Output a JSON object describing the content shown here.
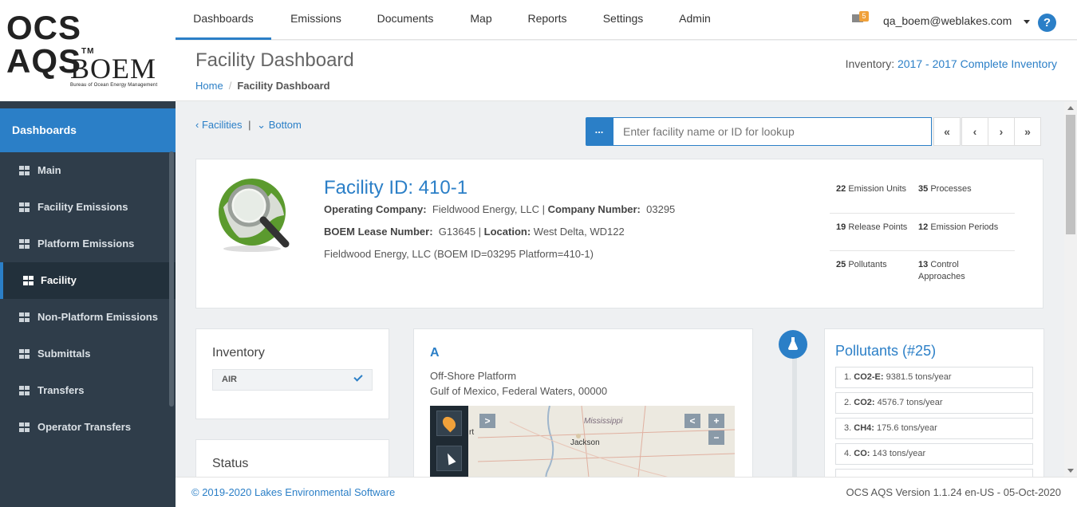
{
  "logo": {
    "app_name": "OCS AQS",
    "tm": "TM",
    "agency": "BOEM",
    "agency_sub": "Bureau of Ocean Energy Management"
  },
  "topnav": {
    "tabs": [
      {
        "label": "Dashboards",
        "active": true
      },
      {
        "label": "Emissions"
      },
      {
        "label": "Documents"
      },
      {
        "label": "Map"
      },
      {
        "label": "Reports"
      },
      {
        "label": "Settings"
      },
      {
        "label": "Admin"
      }
    ],
    "mail_count": "5",
    "user": "qa_boem@weblakes.com",
    "help": "?"
  },
  "header": {
    "title": "Facility Dashboard",
    "breadcrumb": {
      "home": "Home",
      "sep": "/",
      "current": "Facility Dashboard"
    },
    "inventory_label": "Inventory:",
    "inventory_value": "2017 - 2017 Complete Inventory"
  },
  "sidebar": {
    "section": "Dashboards",
    "items": [
      {
        "label": "Main"
      },
      {
        "label": "Facility Emissions"
      },
      {
        "label": "Platform Emissions"
      },
      {
        "label": "Facility",
        "active": true
      },
      {
        "label": "Non-Platform Emissions"
      },
      {
        "label": "Submittals"
      },
      {
        "label": "Transfers"
      },
      {
        "label": "Operator Transfers"
      }
    ]
  },
  "toolbar": {
    "facilities_link": "Facilities",
    "separator": "|",
    "bottom_link": "Bottom",
    "lookup_button": "...",
    "lookup_placeholder": "Enter facility name or ID for lookup",
    "pager": [
      "«",
      "‹",
      "›",
      "»"
    ]
  },
  "facility": {
    "title": "Facility ID: 410-1",
    "op_company_label": "Operating Company:",
    "op_company": "Fieldwood Energy, LLC",
    "company_number_label": "Company Number:",
    "company_number": "03295",
    "lease_label": "BOEM Lease Number:",
    "lease": "G13645",
    "location_label": "Location:",
    "location": "West Delta, WD122",
    "description": "Fieldwood Energy, LLC (BOEM ID=03295 Platform=410-1)",
    "stats": [
      [
        {
          "num": "22",
          "text": "Emission Units"
        },
        {
          "num": "35",
          "text": "Processes"
        }
      ],
      [
        {
          "num": "19",
          "text": "Release Points"
        },
        {
          "num": "12",
          "text": "Emission Periods"
        }
      ],
      [
        {
          "num": "25",
          "text": "Pollutants"
        },
        {
          "num": "13",
          "text": "Control Approaches"
        }
      ]
    ]
  },
  "inventory_card": {
    "title": "Inventory",
    "item": "AIR"
  },
  "status_card": {
    "title": "Status"
  },
  "platform_card": {
    "title": "A",
    "line1": "Off-Shore Platform",
    "line2": "Gulf of Mexico, Federal Waters, 00000",
    "map_labels": {
      "state": "Mississippi",
      "city": "Jackson",
      "edge": "rt"
    },
    "map_buttons": {
      "expand": ">",
      "collapse": "<",
      "zoom_in": "+",
      "zoom_out": "−"
    }
  },
  "pollutants": {
    "title": "Pollutants (#25)",
    "items": [
      {
        "idx": "1.",
        "name": "CO2-E:",
        "value": "9381.5 tons/year"
      },
      {
        "idx": "2.",
        "name": "CO2:",
        "value": "4576.7 tons/year"
      },
      {
        "idx": "3.",
        "name": "CH4:",
        "value": "175.6 tons/year"
      },
      {
        "idx": "4.",
        "name": "CO:",
        "value": "143 tons/year"
      }
    ]
  },
  "footer": {
    "copyright": "© 2019-2020 Lakes Environmental Software",
    "version": "OCS AQS Version 1.1.24 en-US - 05-Oct-2020"
  },
  "colors": {
    "accent": "#2b7fc7",
    "sidebar": "#2f3d4a",
    "badge": "#f0a13a"
  }
}
